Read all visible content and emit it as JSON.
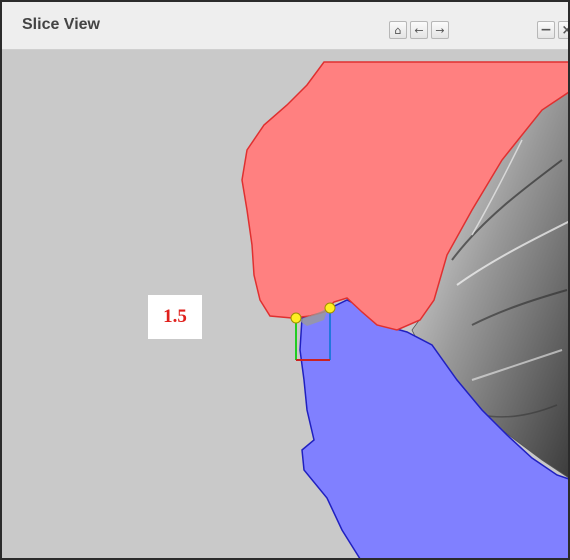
{
  "window": {
    "title": "Slice View",
    "icons": {
      "home": "home-icon",
      "back": "arrow-left-icon",
      "forward": "arrow-right-icon",
      "minimize": "minimize-icon",
      "close": "close-icon"
    },
    "glyphs": {
      "home": "⌂",
      "back": "←",
      "forward": "→",
      "minimize": "−",
      "close": "×"
    }
  },
  "viewport": {
    "measurement_value": "1.5",
    "colors": {
      "background": "#c9c9c9",
      "upper_region": "#ff8080",
      "upper_outline": "#e03030",
      "lower_region": "#8080ff",
      "lower_outline": "#2020c0",
      "endpoint": "#ffee22",
      "marker_green": "#22cc22",
      "marker_red": "#cc2222",
      "marker_blue": "#2277dd",
      "label_text": "#e0201c"
    }
  }
}
